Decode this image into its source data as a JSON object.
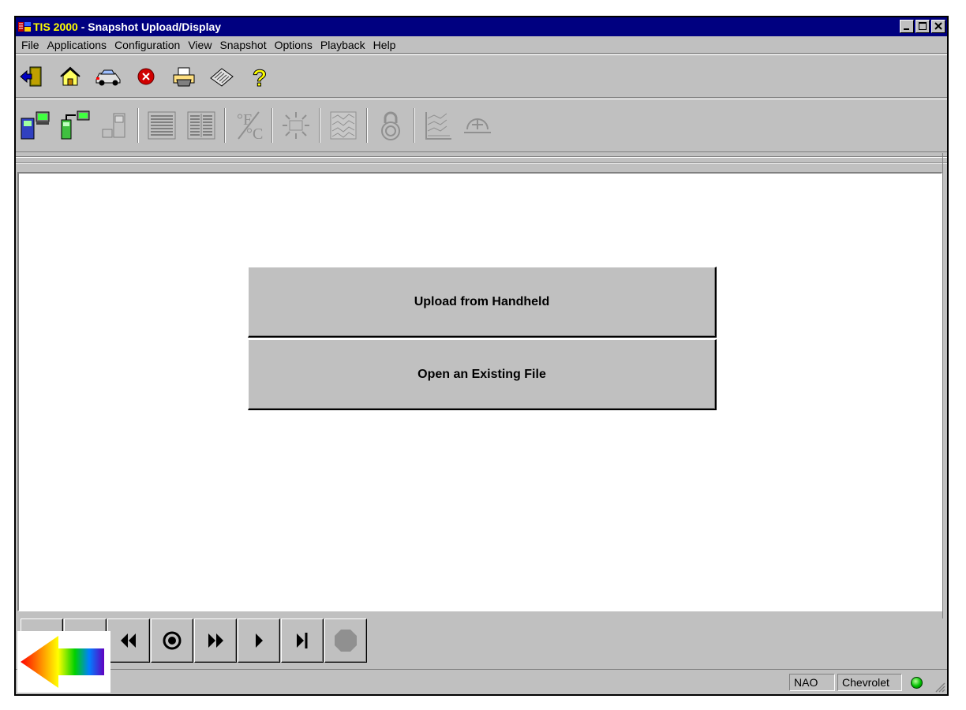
{
  "window": {
    "title_app": "TIS 2000",
    "title_rest": " - Snapshot Upload/Display",
    "title_bar_color": "#000080"
  },
  "menu": [
    {
      "id": "file",
      "label": "File"
    },
    {
      "id": "applications",
      "label": "Applications"
    },
    {
      "id": "configuration",
      "label": "Configuration"
    },
    {
      "id": "view",
      "label": "View"
    },
    {
      "id": "snapshot",
      "label": "Snapshot"
    },
    {
      "id": "options",
      "label": "Options"
    },
    {
      "id": "playback",
      "label": "Playback"
    },
    {
      "id": "help",
      "label": "Help"
    }
  ],
  "toolbar_icons": [
    "exit-icon",
    "home-icon",
    "vehicle-icon",
    "stop-icon",
    "print-icon",
    "keypad-icon",
    "help-icon"
  ],
  "snapshot_toolbar_icons": [
    "handheld-upload-icon",
    "transfer-icon",
    "handheld-disabled-icon",
    "single-column-icon",
    "double-column-icon",
    "temperature-unit-icon",
    "lamp-icon",
    "graph-icon",
    "lock-icon",
    "graph-lines-icon",
    "trigger-icon"
  ],
  "main": {
    "upload_label": "Upload from Handheld",
    "open_label": "Open an Existing File"
  },
  "playback_controls": [
    "first-icon",
    "previous-icon",
    "rewind-icon",
    "record-icon",
    "fast-forward-icon",
    "play-icon",
    "last-icon",
    "stop-octagon-icon"
  ],
  "status": {
    "region": "NAO",
    "make": "Chevrolet",
    "connection_color": "#00c000"
  }
}
